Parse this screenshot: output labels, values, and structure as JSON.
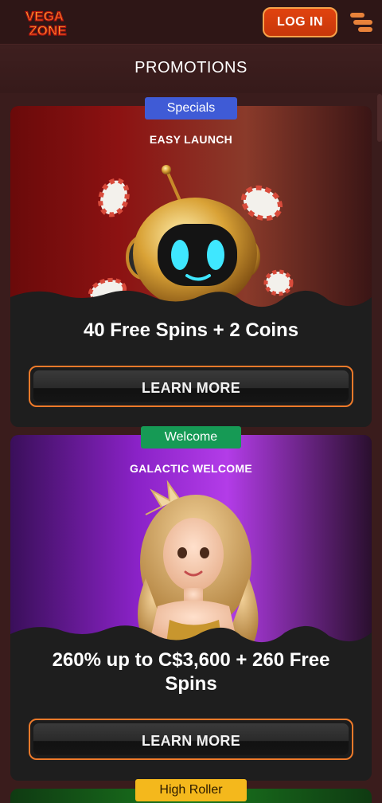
{
  "header": {
    "logo_text_top": "VEGA",
    "logo_text_bottom": "ZONE",
    "login_label": "LOG IN",
    "menu_icon": "menu-icon"
  },
  "page": {
    "title": "PROMOTIONS"
  },
  "promotions": [
    {
      "badge": "Specials",
      "badge_color": "#3f5bd6",
      "subtitle": "EASY LAUNCH",
      "headline": "40 Free Spins + 2 Coins",
      "button": "LEARN MORE",
      "art": "robot-mascot-with-casino-chips"
    },
    {
      "badge": "Welcome",
      "badge_color": "#169a55",
      "subtitle": "GALACTIC WELCOME",
      "headline": "260% up to C$3,600 + 260 Free Spins",
      "button": "LEARN MORE",
      "art": "blonde-woman-character"
    },
    {
      "badge": "High Roller",
      "badge_color": "#f4b81c"
    }
  ],
  "colors": {
    "accent_orange": "#e1430f",
    "background": "#3a1c1c",
    "card": "#1e1e1e"
  }
}
